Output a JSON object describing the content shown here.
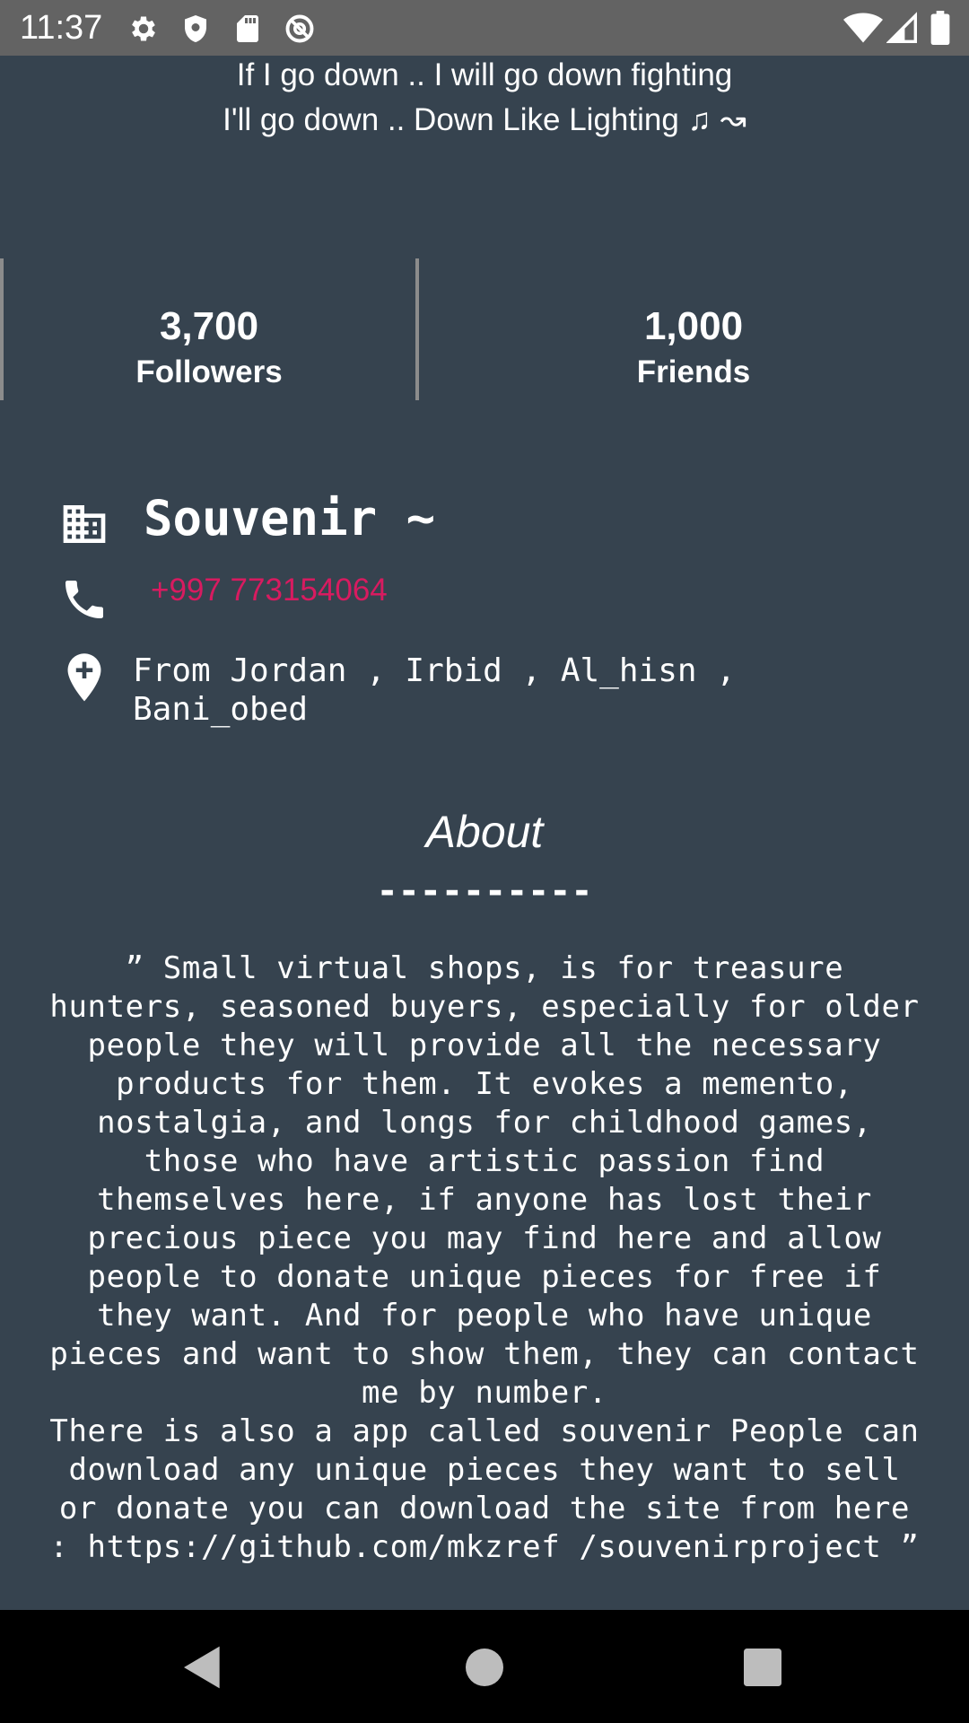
{
  "status_bar": {
    "time": "11:37",
    "icons": [
      "settings-icon",
      "shield-icon",
      "sd-card-icon",
      "at-icon",
      "wifi-icon",
      "signal-icon",
      "battery-icon"
    ]
  },
  "profile": {
    "quote_line1": "If I go down .. I will go down fighting",
    "quote_line2": "I'll go down .. Down Like Lighting ♫ ↝",
    "stats": [
      {
        "value": "3,700",
        "label": "Followers"
      },
      {
        "value": "1,000",
        "label": "Friends"
      }
    ],
    "name": "Souvenir ~",
    "phone": "+997 773154064",
    "location": "From Jordan , Irbid , Al_hisn , Bani_obed",
    "about_title": "About",
    "about_dashes": "----------",
    "about_text": "” Small virtual shops, is for treasure hunters, seasoned buyers, especially for older people they will provide all the necessary products for them. It evokes a memento, nostalgia, and longs for childhood games, those who have artistic passion find themselves here, if anyone has lost their precious piece you may find here and allow people to donate unique pieces for free if they want. And for people who have unique pieces and want to show them, they can contact me by number.\n There is also a app called souvenir People can download any unique pieces they want to sell or donate you can download the site from here : https://github.com/mkzref /souvenirproject ”"
  },
  "colors": {
    "background": "#36434f",
    "status_bar": "#636363",
    "phone_accent": "#d81b60",
    "nav_bar": "#000000"
  },
  "nav_bar": {
    "buttons": [
      "back-icon",
      "home-icon",
      "recents-icon"
    ]
  }
}
